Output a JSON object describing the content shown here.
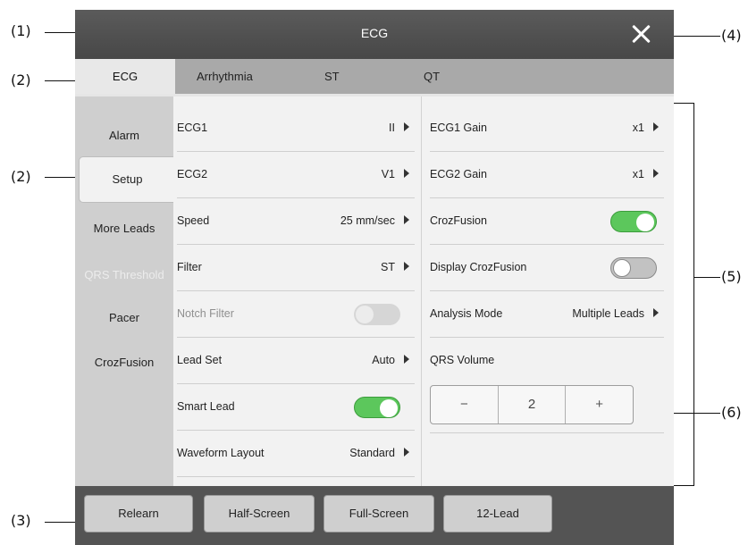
{
  "callouts": {
    "c1": "(1)",
    "c2a": "(2)",
    "c2b": "(2)",
    "c3": "(3)",
    "c4": "(4)",
    "c5": "(5)",
    "c6": "(6)"
  },
  "window": {
    "title": "ECG"
  },
  "tabs": [
    {
      "label": "ECG",
      "active": true
    },
    {
      "label": "Arrhythmia"
    },
    {
      "label": "ST"
    },
    {
      "label": "QT"
    }
  ],
  "sidemenu": [
    {
      "label": "Alarm"
    },
    {
      "label": "Setup",
      "active": true
    },
    {
      "label": "More Leads"
    },
    {
      "label": "QRS Threshold",
      "disabled": true
    },
    {
      "label": "Pacer"
    },
    {
      "label": "CrozFusion"
    }
  ],
  "left_settings": [
    {
      "label": "ECG1",
      "value": "II"
    },
    {
      "label": "ECG2",
      "value": "V1"
    },
    {
      "label": "Speed",
      "value": "25 mm/sec"
    },
    {
      "label": "Filter",
      "value": "ST"
    },
    {
      "label": "Notch Filter",
      "toggle": "disabled"
    },
    {
      "label": "Lead Set",
      "value": "Auto"
    },
    {
      "label": "Smart Lead",
      "toggle": "on"
    },
    {
      "label": "Waveform Layout",
      "value": "Standard"
    }
  ],
  "right_settings": [
    {
      "label": "ECG1 Gain",
      "value": "x1"
    },
    {
      "label": "ECG2 Gain",
      "value": "x1"
    },
    {
      "label": "CrozFusion",
      "toggle": "on"
    },
    {
      "label": "Display CrozFusion",
      "toggle": "off"
    },
    {
      "label": "Analysis Mode",
      "value": "Multiple Leads"
    },
    {
      "label": "QRS Volume"
    }
  ],
  "qrs_volume": {
    "minus": "−",
    "value": "2",
    "plus": "+"
  },
  "bottom_buttons": [
    {
      "label": "Relearn"
    },
    {
      "label": "Half-Screen"
    },
    {
      "label": "Full-Screen"
    },
    {
      "label": "12-Lead"
    }
  ],
  "colors": {
    "toggle_on": "#5cc75c",
    "titlebar": "#4e4e4e",
    "bottombar": "#545454"
  }
}
